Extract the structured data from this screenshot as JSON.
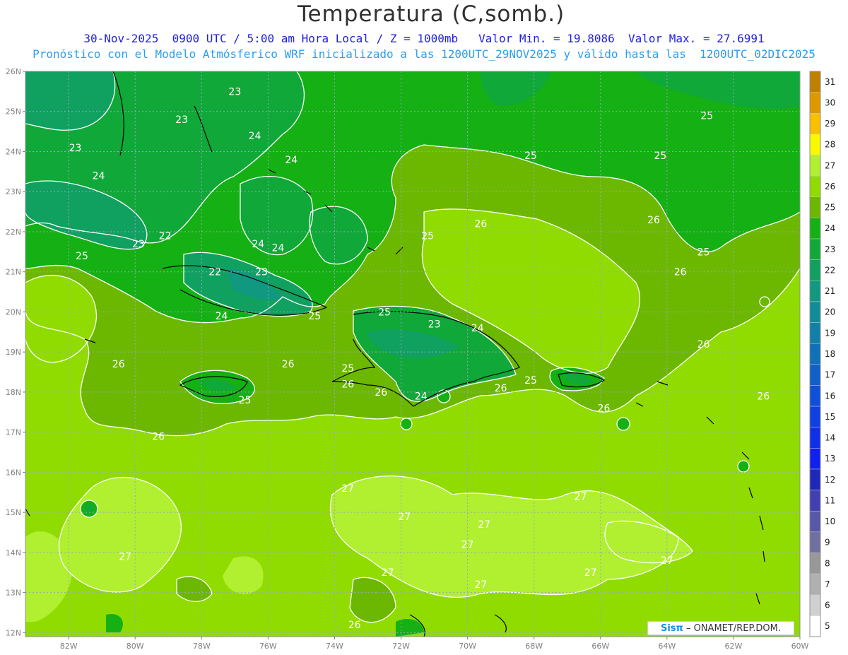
{
  "header": {
    "title": "Temperatura (C,somb.)",
    "line1": "30-Nov-2025  0900 UTC / 5:00 am Hora Local / Z = 1000mb   Valor Min. = 19.8086  Valor Max. = 27.6991",
    "line2": "Pronóstico con el Modelo Atmósferico WRF inicializado a las 1200UTC_29NOV2025 y válido hasta las  1200UTC_02DIC2025"
  },
  "map": {
    "lat_labels": [
      "26N",
      "25N",
      "24N",
      "23N",
      "22N",
      "21N",
      "20N",
      "19N",
      "18N",
      "17N",
      "16N",
      "15N",
      "14N",
      "13N",
      "12N"
    ],
    "lon_labels": [
      "82W",
      "80W",
      "78W",
      "76W",
      "74W",
      "72W",
      "70W",
      "68W",
      "66W",
      "64W",
      "62W",
      "60W"
    ],
    "contour_labels": [
      {
        "text": "23",
        "lon": -77.0,
        "lat": 25.5
      },
      {
        "text": "23",
        "lon": -78.6,
        "lat": 24.8
      },
      {
        "text": "23",
        "lon": -81.8,
        "lat": 24.1
      },
      {
        "text": "24",
        "lon": -76.4,
        "lat": 24.4
      },
      {
        "text": "24",
        "lon": -75.3,
        "lat": 23.8
      },
      {
        "text": "24",
        "lon": -81.1,
        "lat": 23.4
      },
      {
        "text": "22",
        "lon": -79.1,
        "lat": 21.9
      },
      {
        "text": "23",
        "lon": -79.9,
        "lat": 21.7
      },
      {
        "text": "24",
        "lon": -76.3,
        "lat": 21.7
      },
      {
        "text": "24",
        "lon": -75.7,
        "lat": 21.6
      },
      {
        "text": "25",
        "lon": -81.6,
        "lat": 21.4
      },
      {
        "text": "22",
        "lon": -77.6,
        "lat": 21.0
      },
      {
        "text": "23",
        "lon": -76.2,
        "lat": 21.0
      },
      {
        "text": "24",
        "lon": -77.4,
        "lat": 19.9
      },
      {
        "text": "25",
        "lon": -74.6,
        "lat": 19.9
      },
      {
        "text": "25",
        "lon": -72.5,
        "lat": 20.0
      },
      {
        "text": "23",
        "lon": -71.0,
        "lat": 19.7
      },
      {
        "text": "24",
        "lon": -69.7,
        "lat": 19.6
      },
      {
        "text": "25",
        "lon": -73.6,
        "lat": 18.6
      },
      {
        "text": "26",
        "lon": -73.6,
        "lat": 18.2
      },
      {
        "text": "24",
        "lon": -71.4,
        "lat": 17.9
      },
      {
        "text": "25",
        "lon": -68.1,
        "lat": 18.3
      },
      {
        "text": "26",
        "lon": -69.0,
        "lat": 18.1
      },
      {
        "text": "26",
        "lon": -72.6,
        "lat": 18.0
      },
      {
        "text": "25",
        "lon": -76.7,
        "lat": 17.8
      },
      {
        "text": "26",
        "lon": -80.5,
        "lat": 18.7
      },
      {
        "text": "26",
        "lon": -75.4,
        "lat": 18.7
      },
      {
        "text": "26",
        "lon": -79.3,
        "lat": 16.9
      },
      {
        "text": "26",
        "lon": -65.9,
        "lat": 17.6
      },
      {
        "text": "26",
        "lon": -61.1,
        "lat": 17.9
      },
      {
        "text": "26",
        "lon": -62.9,
        "lat": 19.2
      },
      {
        "text": "26",
        "lon": -69.6,
        "lat": 22.2
      },
      {
        "text": "26",
        "lon": -64.4,
        "lat": 22.3
      },
      {
        "text": "26",
        "lon": -63.6,
        "lat": 21.0
      },
      {
        "text": "25",
        "lon": -68.1,
        "lat": 23.9
      },
      {
        "text": "25",
        "lon": -62.8,
        "lat": 24.9
      },
      {
        "text": "25",
        "lon": -64.2,
        "lat": 23.9
      },
      {
        "text": "25",
        "lon": -71.2,
        "lat": 21.9
      },
      {
        "text": "25",
        "lon": -62.9,
        "lat": 21.5
      },
      {
        "text": "27",
        "lon": -73.6,
        "lat": 15.6
      },
      {
        "text": "27",
        "lon": -71.9,
        "lat": 14.9
      },
      {
        "text": "27",
        "lon": -69.5,
        "lat": 14.7
      },
      {
        "text": "27",
        "lon": -70.0,
        "lat": 14.2
      },
      {
        "text": "27",
        "lon": -80.3,
        "lat": 13.9
      },
      {
        "text": "27",
        "lon": -72.4,
        "lat": 13.5
      },
      {
        "text": "27",
        "lon": -69.6,
        "lat": 13.2
      },
      {
        "text": "27",
        "lon": -66.3,
        "lat": 13.5
      },
      {
        "text": "27",
        "lon": -64.0,
        "lat": 13.8
      },
      {
        "text": "27",
        "lon": -66.6,
        "lat": 15.4
      },
      {
        "text": "26",
        "lon": -73.4,
        "lat": 12.2
      }
    ]
  },
  "colorbar": {
    "levels": [
      "31",
      "30",
      "29",
      "28",
      "27",
      "26",
      "25",
      "24",
      "23",
      "22",
      "21",
      "20",
      "19",
      "18",
      "17",
      "16",
      "15",
      "14",
      "13",
      "12",
      "11",
      "10",
      "9",
      "8",
      "7",
      "6",
      "5"
    ],
    "colors": [
      "#c08000",
      "#e09800",
      "#f8c000",
      "#f8f800",
      "#b0f030",
      "#90dc00",
      "#6cb800",
      "#14b014",
      "#10a838",
      "#10a060",
      "#109880",
      "#108c98",
      "#1080a8",
      "#1070b8",
      "#1060c8",
      "#1050d8",
      "#1040e0",
      "#1030e8",
      "#1020f0",
      "#2028b8",
      "#4040b0",
      "#5858a8",
      "#7070a0",
      "#989898",
      "#b0b0b0",
      "#d0d0d0",
      "#ffffff"
    ]
  },
  "credit": {
    "brand": "Sisπ",
    "org": "– ONAMET/REP.DOM."
  }
}
